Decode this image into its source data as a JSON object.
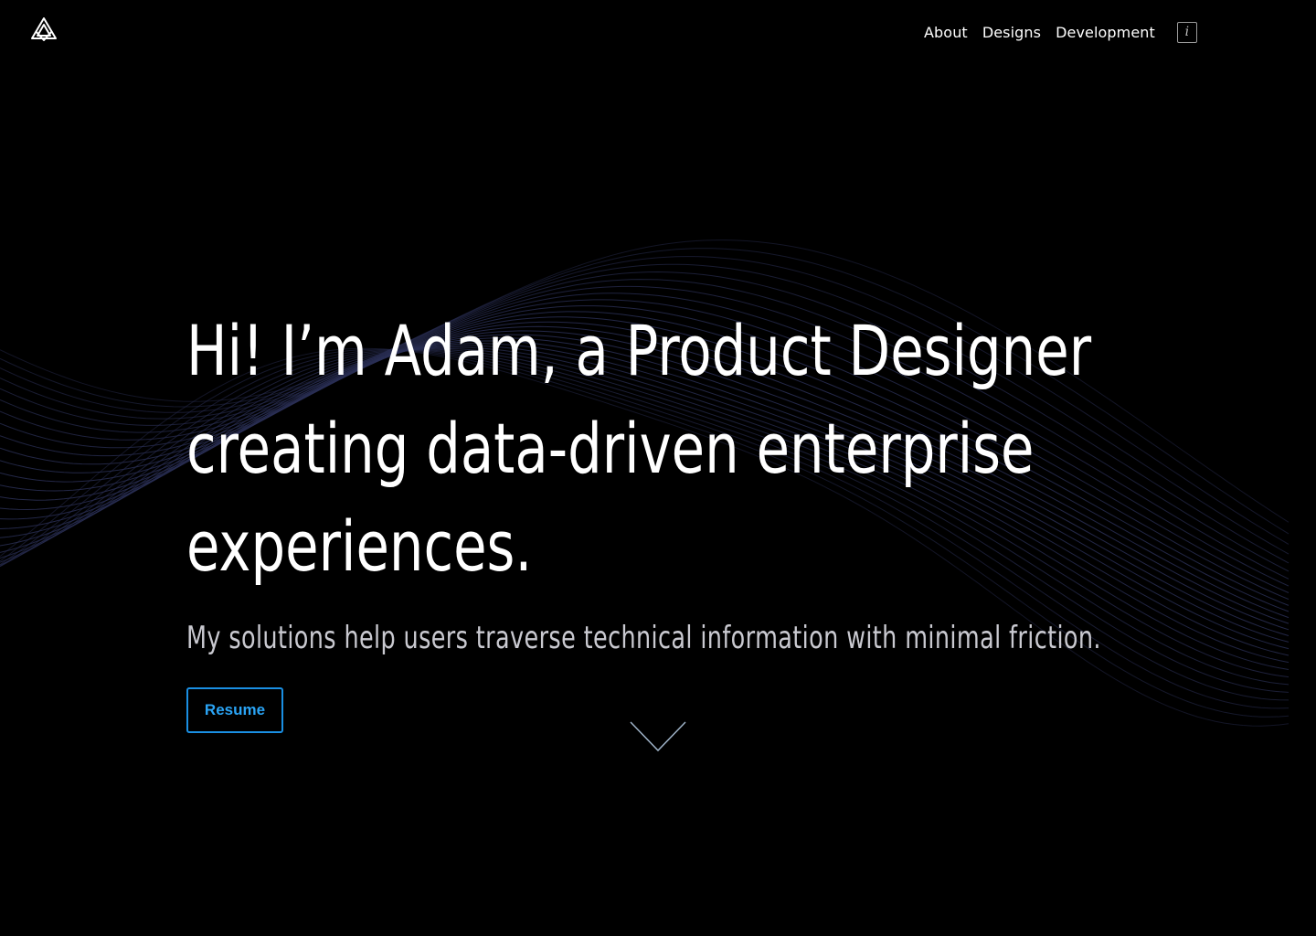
{
  "nav": {
    "items": [
      {
        "label": "About"
      },
      {
        "label": "Designs"
      },
      {
        "label": "Development"
      }
    ],
    "info_icon_glyph": "i",
    "info_icon": "info-icon"
  },
  "logo": {
    "icon": "triangle-monogram-logo"
  },
  "hero": {
    "title_lines": [
      "Hi! I’m Adam, a Product Designer",
      "creating data-driven enterprise",
      "experiences."
    ],
    "subtitle": "My solutions help users traverse technical information with minimal friction.",
    "resume_label": "Resume",
    "scroll_icon": "chevron-down-icon"
  },
  "colors": {
    "background": "#000000",
    "text": "#ffffff",
    "subtitle": "#c9c9d0",
    "accent": "#1a8fe3",
    "wave": "#2a2f55"
  }
}
